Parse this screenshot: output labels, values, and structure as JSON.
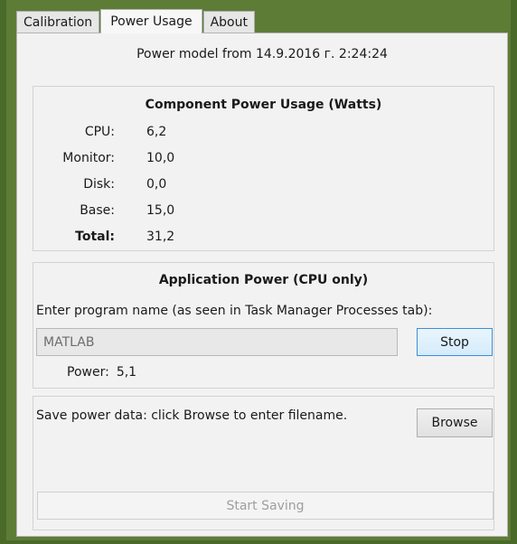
{
  "tabs": [
    {
      "label": "Calibration",
      "active": false
    },
    {
      "label": "Power Usage",
      "active": true
    },
    {
      "label": "About",
      "active": false
    }
  ],
  "model_line": "Power model from 14.9.2016 г. 2:24:24",
  "component": {
    "title": "Component Power Usage (Watts)",
    "rows": [
      {
        "label": "CPU:",
        "value": "6,2"
      },
      {
        "label": "Monitor:",
        "value": "10,0"
      },
      {
        "label": "Disk:",
        "value": "0,0"
      },
      {
        "label": "Base:",
        "value": "15,0"
      },
      {
        "label": "Total:",
        "value": "31,2"
      }
    ]
  },
  "application": {
    "title": "Application Power (CPU only)",
    "prompt": "Enter program name (as seen in Task Manager Processes tab):",
    "program_value": "MATLAB",
    "stop_label": "Stop",
    "power_label": "Power:",
    "power_value": "5,1"
  },
  "save": {
    "text": "Save power data: click Browse to enter filename.",
    "browse_label": "Browse",
    "start_label": "Start Saving"
  }
}
